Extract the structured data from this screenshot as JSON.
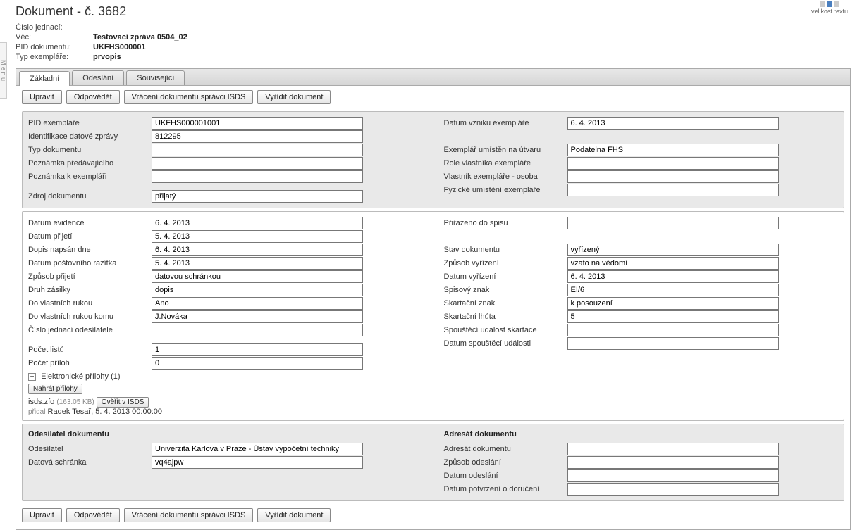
{
  "textSizeLabel": "velikost textu",
  "sideHandle": "M e n u",
  "title": "Dokument - č. 3682",
  "header": {
    "lbl_cj": "Číslo jednací:",
    "val_cj": "",
    "lbl_vec": "Věc:",
    "val_vec": "Testovací zpráva 0504_02",
    "lbl_pid": "PID dokumentu:",
    "val_pid": "UKFHS000001",
    "lbl_typ": "Typ exempláře:",
    "val_typ": "prvopis"
  },
  "tabs": {
    "t1": "Základní",
    "t2": "Odeslání",
    "t3": "Související"
  },
  "buttons": {
    "upravit": "Upravit",
    "odpovedet": "Odpovědět",
    "vraceni": "Vrácení dokumentu správci ISDS",
    "vyridit": "Vyřídit dokument",
    "nahrat": "Nahrát přílohy",
    "overit": "Ověřit v ISDS"
  },
  "p1": {
    "l_pidex": "PID exempláře",
    "v_pidex": "UKFHS000001001",
    "l_idz": "Identifikace datové zprávy",
    "v_idz": "812295",
    "l_typd": "Typ dokumentu",
    "v_typd": "",
    "l_pozp": "Poznámka předávajícího",
    "v_pozp": "",
    "l_poze": "Poznámka k exempláři",
    "v_poze": "",
    "l_zdroj": "Zdroj dokumentu",
    "v_zdroj": "přijatý",
    "l_dvz": "Datum vzniku exempláře",
    "v_dvz": "6. 4. 2013",
    "l_utvar": "Exemplář umístěn na útvaru",
    "v_utvar": "Podatelna FHS",
    "l_role": "Role vlastníka exempláře",
    "v_role": "",
    "l_vlast": "Vlastník exempláře - osoba",
    "v_vlast": "",
    "l_fyz": "Fyzické umístění exempláře",
    "v_fyz": ""
  },
  "p2": {
    "l_dev": "Datum evidence",
    "v_dev": "6. 4. 2013",
    "l_dpr": "Datum přijetí",
    "v_dpr": "5. 4. 2013",
    "l_dnap": "Dopis napsán dne",
    "v_dnap": "6. 4. 2013",
    "l_draz": "Datum poštovního razítka",
    "v_draz": "5. 4. 2013",
    "l_zpr": "Způsob přijetí",
    "v_zpr": "datovou schránkou",
    "l_druh": "Druh zásilky",
    "v_druh": "dopis",
    "l_dvr": "Do vlastních rukou",
    "v_dvr": "Ano",
    "l_dvrk": "Do vlastních rukou komu",
    "v_dvrk": "J.Nováka",
    "l_cjo": "Číslo jednací odesílatele",
    "v_cjo": "",
    "l_pl": "Počet listů",
    "v_pl": "1",
    "l_pp": "Počet příloh",
    "v_pp": "0",
    "l_spis": "Přiřazeno do spisu",
    "v_spis": "",
    "l_stav": "Stav dokumentu",
    "v_stav": "vyřízený",
    "l_zvy": "Způsob vyřízení",
    "v_zvy": "vzato na vědomí",
    "l_dvy": "Datum vyřízení",
    "v_dvy": "6. 4. 2013",
    "l_sz": "Spisový znak",
    "v_sz": "EI/6",
    "l_skz": "Skartační znak",
    "v_skz": "k posouzení",
    "l_skl": "Skartační lhůta",
    "v_skl": "5",
    "l_spu": "Spouštěcí událost skartace",
    "v_spu": "",
    "l_dspu": "Datum spouštěcí události",
    "v_dspu": ""
  },
  "attach": {
    "title": "Elektronické přílohy (1)",
    "file": "isds.zfo",
    "size": "(163.05 KB)",
    "added_lbl": "přidal",
    "added_txt": "Radek Tesař, 5. 4. 2013 00:00:00"
  },
  "p3": {
    "h_odes": "Odesílatel dokumentu",
    "l_od": "Odesílatel",
    "v_od": "Univerzita Karlova v Praze - Ústav výpočetní techniky",
    "l_ds": "Datová schránka",
    "v_ds": "vq4ajpw",
    "h_adr": "Adresát dokumentu",
    "l_ad": "Adresát dokumentu",
    "v_ad": "",
    "l_zo": "Způsob odeslání",
    "v_zo": "",
    "l_do": "Datum odeslání",
    "v_do": "",
    "l_dp": "Datum potvrzení o doručení",
    "v_dp": ""
  }
}
